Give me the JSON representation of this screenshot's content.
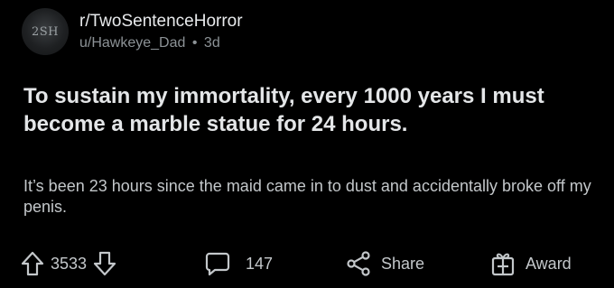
{
  "post": {
    "avatar_text": "2SH",
    "subreddit": "r/TwoSentenceHorror",
    "author": "u/Hawkeye_Dad",
    "separator": "•",
    "age": "3d",
    "title": "To sustain my immortality, every 1000 years I must become a marble statue for 24 hours.",
    "body": "It’s been 23 hours since the maid came in to dust and accidentally broke off my penis."
  },
  "actions": {
    "upvotes": "3533",
    "comments": "147",
    "share_label": "Share",
    "award_label": "Award"
  },
  "icons": {
    "upvote": "arrow-up-icon",
    "downvote": "arrow-down-icon",
    "comment": "comment-bubble-icon",
    "share": "share-icon",
    "award": "gift-icon"
  },
  "colors": {
    "background": "#000000",
    "text": "#e4e6e8",
    "muted": "#8c9296"
  }
}
